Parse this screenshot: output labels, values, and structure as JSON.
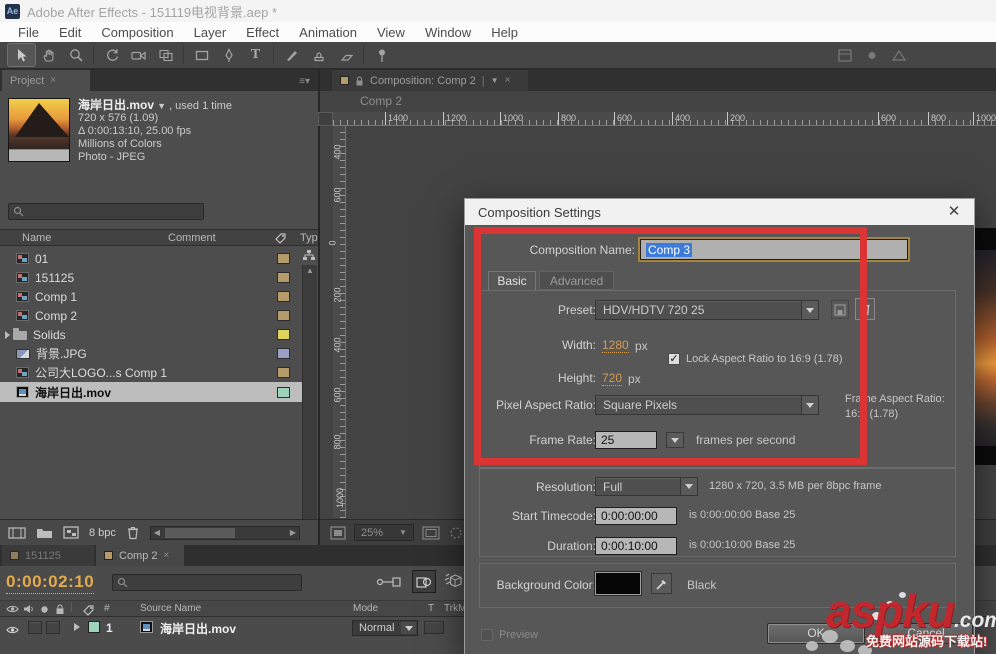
{
  "window": {
    "title": "Adobe After Effects - 151119电视背景.aep *",
    "badge": "Ae"
  },
  "menu": [
    "File",
    "Edit",
    "Composition",
    "Layer",
    "Effect",
    "Animation",
    "View",
    "Window",
    "Help"
  ],
  "project": {
    "tab": "Project",
    "preview_name": "海岸日出.mov",
    "preview_caret": "▼",
    "preview_usage": ", used 1 time",
    "preview_dims": "720 x 576 (1.09)",
    "preview_duration": "Δ 0:00:13:10, 25.00 fps",
    "preview_colors": "Millions of Colors",
    "preview_kind": "Photo - JPEG",
    "col_name": "Name",
    "col_comment": "Comment",
    "col_type": "Type",
    "items": [
      {
        "label": "01",
        "chip": "#b59a6a"
      },
      {
        "label": "151125",
        "chip": "#b59a6a"
      },
      {
        "label": "Comp 1",
        "chip": "#b59a6a"
      },
      {
        "label": "Comp 2",
        "chip": "#b59a6a"
      },
      {
        "label": "Solids",
        "chip": "#ded45e"
      },
      {
        "label": "背景.JPG",
        "chip": "#999fc7"
      },
      {
        "label": "公司大LOGO...s Comp 1",
        "chip": "#b59a6a"
      },
      {
        "label": "海岸日出.mov",
        "chip": "#9dd3ba"
      }
    ],
    "bpc": "8 bpc"
  },
  "viewer": {
    "tab": "Composition: Comp 2",
    "comp_name": "Comp 2",
    "zoom": "25%",
    "ruler_top": [
      "1400",
      "1200",
      "1000",
      "800",
      "600",
      "400",
      "200",
      "600",
      "800",
      "1000"
    ],
    "ruler_left": [
      "400",
      "600",
      "0",
      "200",
      "400",
      "600",
      "800",
      "1000"
    ]
  },
  "timeline": {
    "tab1": "151125",
    "tab2": "Comp 2",
    "timecode": "0:00:02:10",
    "col_hash": "#",
    "col_source": "Source Name",
    "col_mode": "Mode",
    "col_t": "T",
    "col_trkmat": "TrkM",
    "layer_num": "1",
    "layer_name": "海岸日出.mov",
    "layer_mode": "Normal"
  },
  "dialog": {
    "title": "Composition Settings",
    "close": "✕",
    "name_label": "Composition Name:",
    "name_value": "Comp 3",
    "tab_basic": "Basic",
    "tab_advanced": "Advanced",
    "preset_label": "Preset:",
    "preset_value": "HDV/HDTV 720 25",
    "width_label": "Width:",
    "width_value": "1280",
    "width_unit": "px",
    "height_label": "Height:",
    "height_value": "720",
    "height_unit": "px",
    "lock_label": "Lock Aspect Ratio to 16:9 (1.78)",
    "par_label": "Pixel Aspect Ratio:",
    "par_value": "Square Pixels",
    "far_label": "Frame Aspect Ratio:",
    "far_value": "16:9 (1.78)",
    "rate_label": "Frame Rate:",
    "rate_value": "25",
    "rate_suffix": "frames per second",
    "res_label": "Resolution:",
    "res_value": "Full",
    "res_info": "1280 x 720, 3.5 MB per 8bpc frame",
    "start_label": "Start Timecode:",
    "start_value": "0:00:00:00",
    "start_info": "is 0:00:00:00  Base 25",
    "dur_label": "Duration:",
    "dur_value": "0:00:10:00",
    "dur_info": "is 0:00:10:00  Base 25",
    "bg_label": "Background Color:",
    "bg_name": "Black",
    "preview_label": "Preview",
    "ok": "OK",
    "cancel": "Cancel"
  },
  "watermark": {
    "brand": "aspku",
    "domain": ".com",
    "tagline": "免费网站源码下载站!"
  },
  "colors": {
    "accent_orange": "#d79b4c",
    "timecode": "#e3aa4e",
    "annotation_red": "#da3434",
    "selection_blue": "#3c7bd9"
  }
}
